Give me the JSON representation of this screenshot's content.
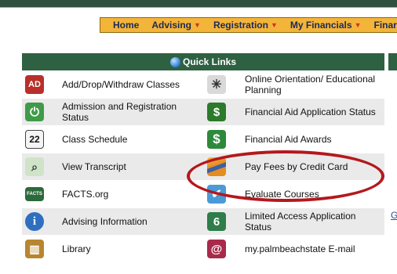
{
  "nav": {
    "items": [
      {
        "label": "Home",
        "has_caret": false
      },
      {
        "label": "Advising",
        "has_caret": true
      },
      {
        "label": "Registration",
        "has_caret": true
      },
      {
        "label": "My Financials",
        "has_caret": true
      },
      {
        "label": "Finar",
        "has_caret": false
      }
    ]
  },
  "quick_links": {
    "title": "Quick Links",
    "rows": [
      {
        "left": {
          "label": "Add/Drop/Withdraw Classes",
          "icon": "add-drop-icon"
        },
        "right": {
          "label": "Online Orientation/ Educational Planning",
          "icon": "orientation-star-icon"
        }
      },
      {
        "left": {
          "label": "Admission and Registration Status",
          "icon": "power-status-icon"
        },
        "right": {
          "label": "Financial Aid Application Status",
          "icon": "money-dollar-icon"
        }
      },
      {
        "left": {
          "label": "Class Schedule",
          "icon": "calendar-22-icon"
        },
        "right": {
          "label": "Financial Aid Awards",
          "icon": "dollar-sign-icon"
        }
      },
      {
        "left": {
          "label": "View Transcript",
          "icon": "transcript-magnifier-icon"
        },
        "right": {
          "label": "Pay Fees by Credit Card",
          "icon": "credit-card-icon"
        }
      },
      {
        "left": {
          "label": "FACTS.org",
          "icon": "facts-logo-icon",
          "icon_text": "FACTS"
        },
        "right": {
          "label": "Evaluate Courses",
          "icon": "checkmark-icon"
        }
      },
      {
        "left": {
          "label": "Advising Information",
          "icon": "info-icon"
        },
        "right": {
          "label": "Limited Access Application Status",
          "icon": "number-6-icon"
        }
      },
      {
        "left": {
          "label": "Library",
          "icon": "book-icon"
        },
        "right": {
          "label": "my.palmbeachstate E-mail",
          "icon": "email-at-icon"
        }
      }
    ]
  },
  "side_link_fragment": "G",
  "colors": {
    "nav_bg": "#f3b43a",
    "header_green": "#2e6141",
    "row_alt": "#eaeaea",
    "highlight_red": "#b4181d"
  }
}
